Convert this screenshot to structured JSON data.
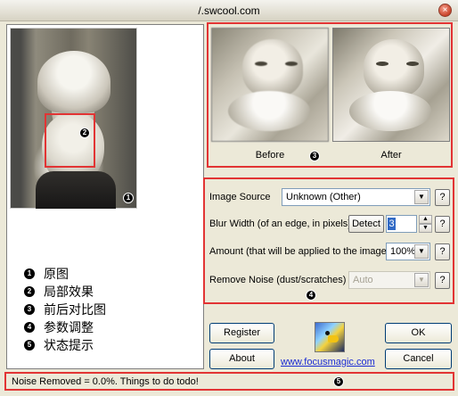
{
  "window": {
    "title": "/.swcool.com",
    "close_label": "×"
  },
  "left_pane": {
    "badge_original": "1",
    "badge_local": "2"
  },
  "legend": [
    {
      "badge": "1",
      "label": "原图"
    },
    {
      "badge": "2",
      "label": "局部效果"
    },
    {
      "badge": "3",
      "label": "前后对比图"
    },
    {
      "badge": "4",
      "label": "参数调整"
    },
    {
      "badge": "5",
      "label": "状态提示"
    }
  ],
  "preview": {
    "before_label": "Before",
    "after_label": "After",
    "badge": "3"
  },
  "settings": {
    "image_source_label": "Image Source",
    "image_source_value": "Unknown (Other)",
    "blur_width_label": "Blur Width (of an edge, in pixels)",
    "detect_label": "Detect",
    "blur_width_value": "3",
    "amount_label": "Amount (that will be applied to the image)",
    "amount_value": "100%",
    "remove_noise_label": "Remove Noise (dust/scratches)",
    "remove_noise_value": "Auto",
    "help_label": "?",
    "badge": "4"
  },
  "buttons": {
    "register": "Register",
    "about": "About",
    "ok": "OK",
    "cancel": "Cancel"
  },
  "link": "www.focusmagic.com",
  "status": {
    "text": "Noise Removed = 0.0%. Things to do todo!",
    "badge": "5"
  },
  "icons": {
    "close": "close-icon",
    "combo_arrow": "chevron-down-icon",
    "spin_up": "chevron-up-icon",
    "spin_down": "chevron-down-icon",
    "logo": "focus-magic-logo-icon"
  },
  "colors": {
    "highlight_border": "#e23434",
    "window_bg": "#ece9d8",
    "link": "#1a2bd3"
  }
}
